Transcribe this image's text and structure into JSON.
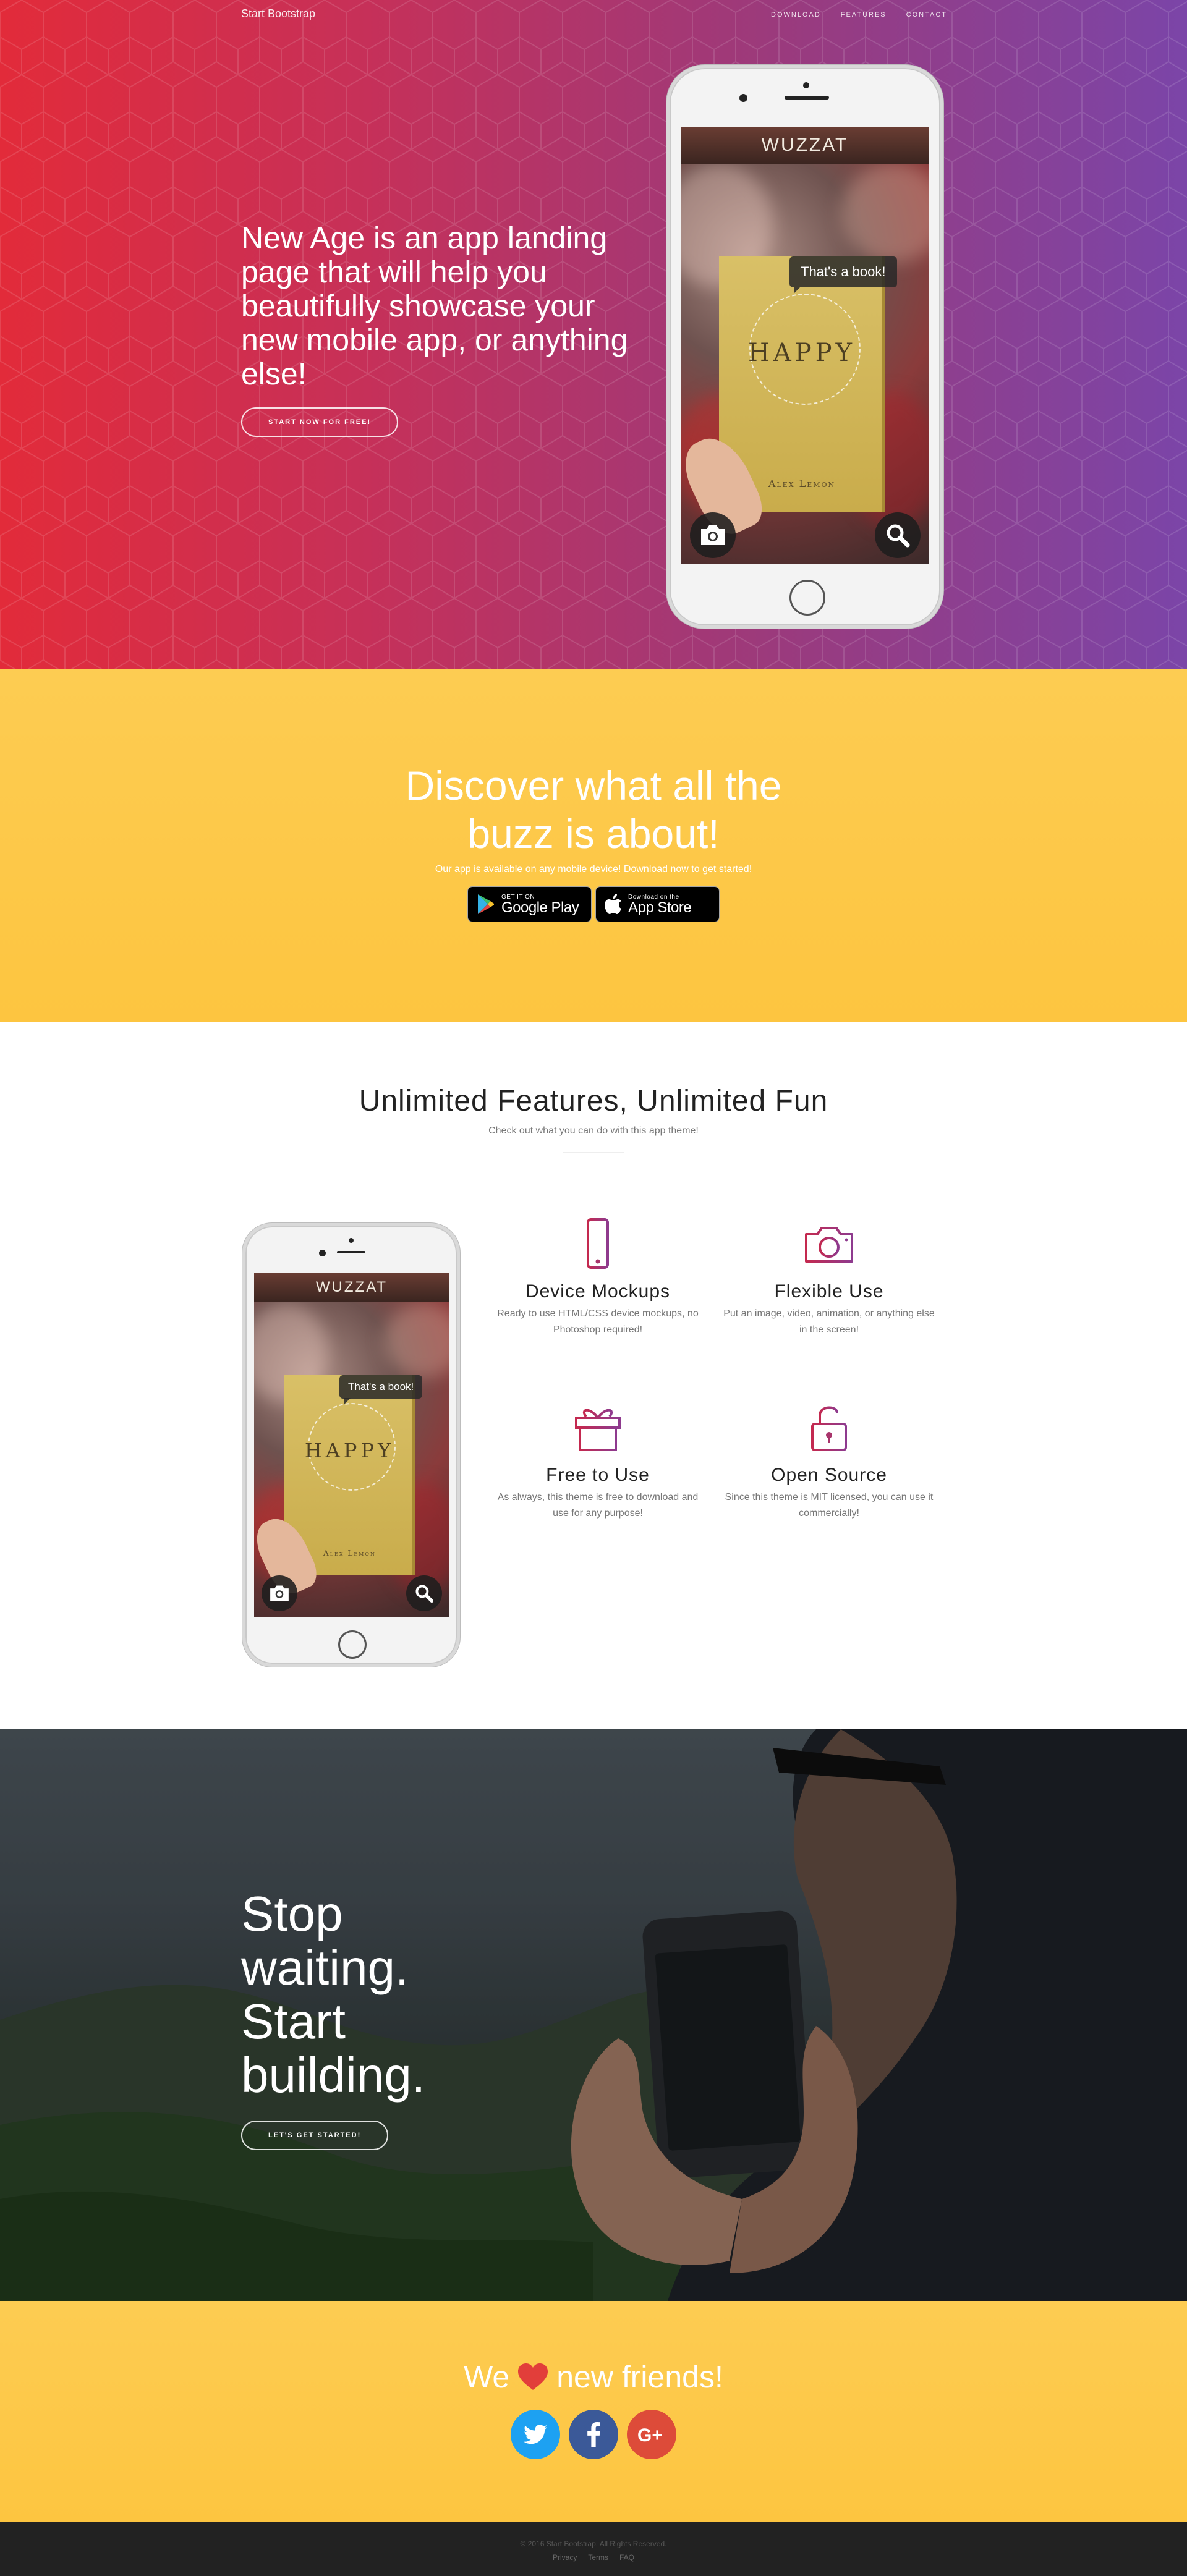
{
  "nav": {
    "brand": "Start Bootstrap",
    "links": [
      "Download",
      "Features",
      "Contact"
    ]
  },
  "hero": {
    "heading": "New Age is an app landing page that will help you beautifully showcase your new mobile app, or anything else!",
    "button": "Start Now for Free!"
  },
  "mockup": {
    "app_title": "WUZZAT",
    "bubble": "That's a book!",
    "book_title": "HAPPY",
    "book_author": "Alex Lemon",
    "icons": [
      "camera-icon",
      "search-icon"
    ]
  },
  "download": {
    "heading_line1": "Discover what all the",
    "heading_line2": "buzz is about!",
    "subtext": "Our app is available on any mobile device! Download now to get started!",
    "google_play": {
      "small": "GET IT ON",
      "big": "Google Play"
    },
    "app_store": {
      "small": "Download on the",
      "big": "App Store"
    }
  },
  "features": {
    "heading": "Unlimited Features, Unlimited Fun",
    "subheading": "Check out what you can do with this app theme!",
    "items": [
      {
        "icon": "phone-icon",
        "title": "Device Mockups",
        "text": "Ready to use HTML/CSS device mockups, no Photoshop required!"
      },
      {
        "icon": "camera-icon",
        "title": "Flexible Use",
        "text": "Put an image, video, animation, or anything else in the screen!"
      },
      {
        "icon": "gift-icon",
        "title": "Free to Use",
        "text": "As always, this theme is free to download and use for any purpose!"
      },
      {
        "icon": "unlock-icon",
        "title": "Open Source",
        "text": "Since this theme is MIT licensed, you can use it commercially!"
      }
    ]
  },
  "cta": {
    "line1": "Stop",
    "line2": "waiting.",
    "line3": "Start",
    "line4": "building.",
    "button": "Let's Get Started!"
  },
  "contact": {
    "before": "We",
    "after": "new friends!",
    "socials": [
      {
        "name": "twitter",
        "glyph": "t",
        "color": "#1da1f2"
      },
      {
        "name": "facebook",
        "glyph": "f",
        "color": "#3b5998"
      },
      {
        "name": "google-plus",
        "glyph": "G+",
        "color": "#dd4b39"
      }
    ]
  },
  "footer": {
    "copyright": "© 2016 Start Bootstrap. All Rights Reserved.",
    "links": [
      "Privacy",
      "Terms",
      "FAQ"
    ]
  },
  "colors": {
    "hero_start": "#e22b3a",
    "hero_end": "#7b45a8",
    "yellow": "#fdcc52",
    "feature_icon": "#b4326f",
    "footer": "#222222",
    "heart": "#e23e3a"
  }
}
